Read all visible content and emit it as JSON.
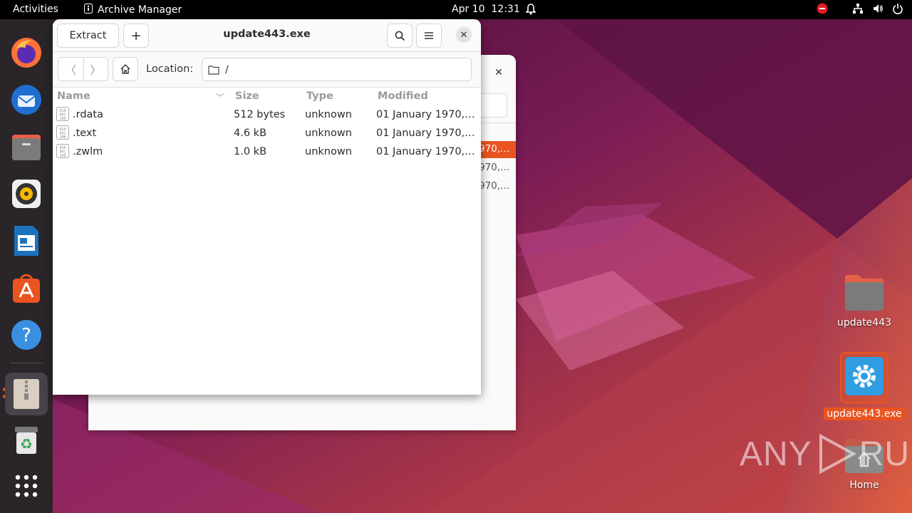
{
  "topbar": {
    "activities": "Activities",
    "app_name": "Archive Manager",
    "date": "Apr 10",
    "time": "12:31"
  },
  "dock": {
    "items": [
      "Firefox",
      "Thunderbird",
      "Files",
      "Rhythmbox",
      "LibreOffice Writer",
      "Ubuntu Software",
      "Help",
      "Archive Manager",
      "Trash",
      "Show Applications"
    ]
  },
  "window": {
    "title": "update443.exe",
    "extract_label": "Extract",
    "add_label": "+",
    "location_label": "Location:",
    "location_value": "/",
    "columns": {
      "name": "Name",
      "size": "Size",
      "type": "Type",
      "modified": "Modified"
    },
    "files": [
      {
        "name": ".rdata",
        "size": "512 bytes",
        "type": "unknown",
        "modified": "01 January 1970,…"
      },
      {
        "name": ".text",
        "size": "4.6 kB",
        "type": "unknown",
        "modified": "01 January 1970,…"
      },
      {
        "name": ".zwlm",
        "size": "1.0 kB",
        "type": "unknown",
        "modified": "01 January 1970,…"
      }
    ]
  },
  "background_window": {
    "rows": [
      "970,…",
      "970,…",
      "970,…"
    ]
  },
  "desktop": {
    "icons": [
      {
        "label": "update443"
      },
      {
        "label": "update443.exe"
      },
      {
        "label": "Home"
      }
    ]
  },
  "watermark": {
    "text_left": "ANY",
    "text_right": "RUN"
  },
  "colors": {
    "accent": "#e95420",
    "topbar": "#000000",
    "dock": "#2a2528"
  }
}
